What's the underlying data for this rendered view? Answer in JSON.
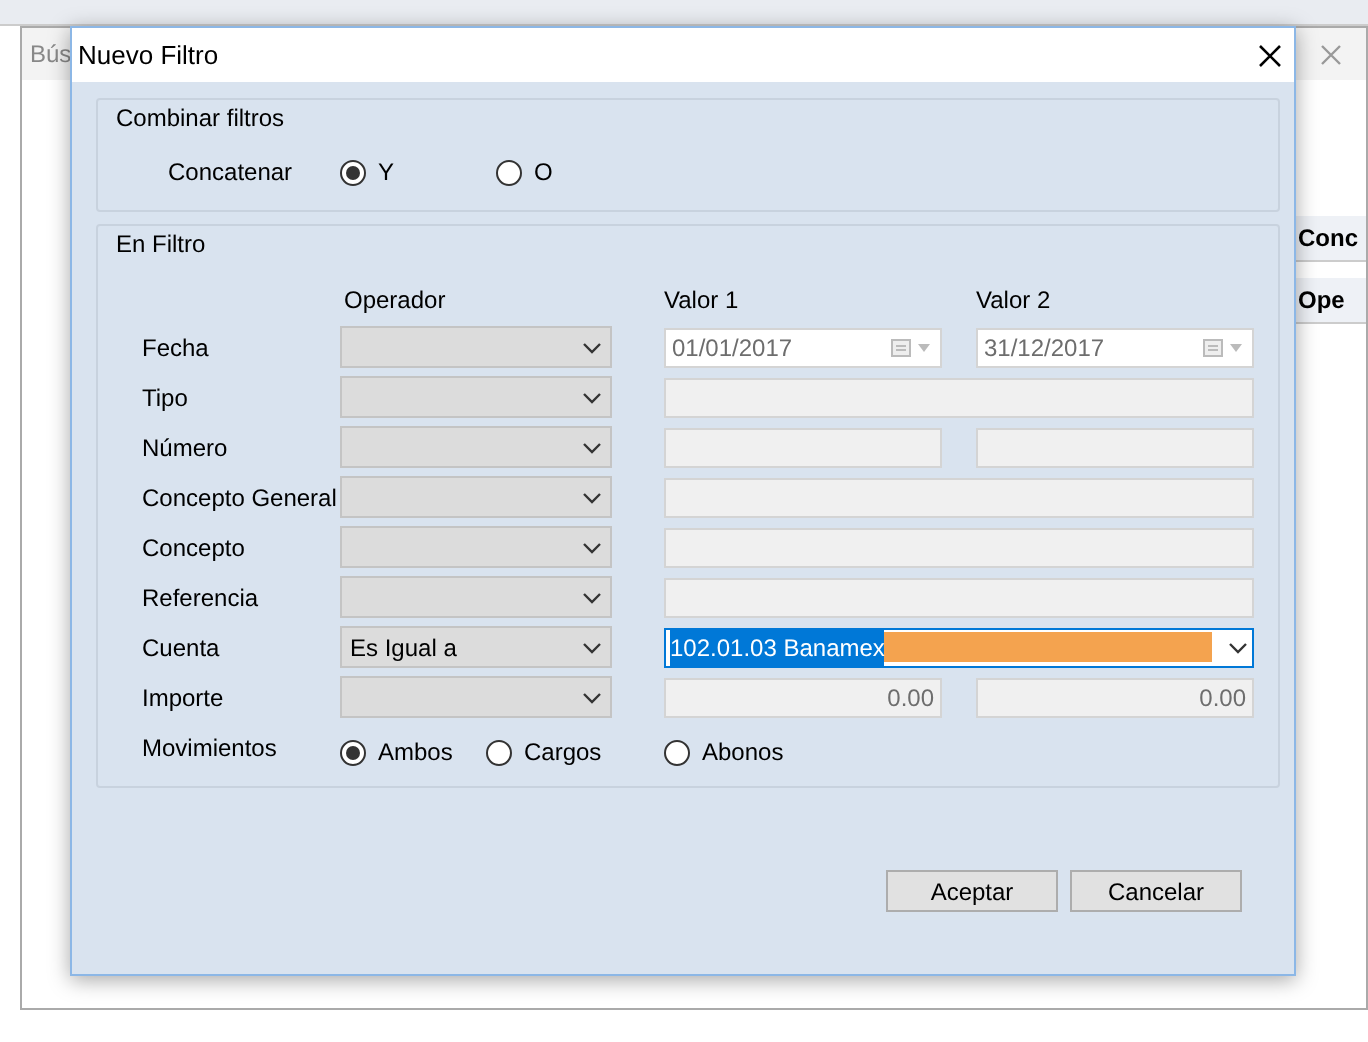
{
  "background_window": {
    "title": "Bús",
    "columns": [
      "Conc",
      "Ope"
    ]
  },
  "dialog": {
    "title": "Nuevo Filtro",
    "combine": {
      "title": "Combinar filtros",
      "label": "Concatenar",
      "options": [
        {
          "label": "Y",
          "selected": true
        },
        {
          "label": "O",
          "selected": false
        }
      ]
    },
    "filter": {
      "title": "En Filtro",
      "headers": [
        "Operador",
        "Valor 1",
        "Valor 2"
      ],
      "rows": [
        {
          "label": "Fecha",
          "kind": "date",
          "operator": {
            "disabled": true
          },
          "value1": {
            "text": "01/01/2017",
            "disabled": true
          },
          "value2": {
            "text": "31/12/2017",
            "disabled": true
          }
        },
        {
          "label": "Tipo",
          "kind": "wide",
          "operator": {
            "disabled": true
          },
          "value1": {
            "disabled": true
          }
        },
        {
          "label": "Número",
          "kind": "pair",
          "operator": {
            "disabled": true
          },
          "value1": {
            "disabled": true
          },
          "value2": {
            "disabled": true
          }
        },
        {
          "label": "Concepto General",
          "kind": "wide",
          "operator": {
            "disabled": true
          },
          "value1": {
            "disabled": true
          }
        },
        {
          "label": "Concepto",
          "kind": "wide",
          "operator": {
            "disabled": true
          },
          "value1": {
            "disabled": true
          }
        },
        {
          "label": "Referencia",
          "kind": "wide",
          "operator": {
            "disabled": true
          },
          "value1": {
            "disabled": true
          }
        },
        {
          "label": "Cuenta",
          "kind": "combo",
          "operator": {
            "text": "Es Igual a",
            "disabled": true
          },
          "value1": {
            "text": "102.01.03 Banamex",
            "disabled": false,
            "focused": true
          }
        },
        {
          "label": "Importe",
          "kind": "pair",
          "operator": {
            "disabled": true
          },
          "value1": {
            "text": "0.00",
            "disabled": true
          },
          "value2": {
            "text": "0.00",
            "disabled": true
          }
        }
      ],
      "movements": {
        "label": "Movimientos",
        "options": [
          {
            "label": "Ambos",
            "selected": true
          },
          {
            "label": "Cargos",
            "selected": false
          },
          {
            "label": "Abonos",
            "selected": false
          }
        ]
      }
    },
    "buttons": [
      "Aceptar",
      "Cancelar"
    ]
  }
}
